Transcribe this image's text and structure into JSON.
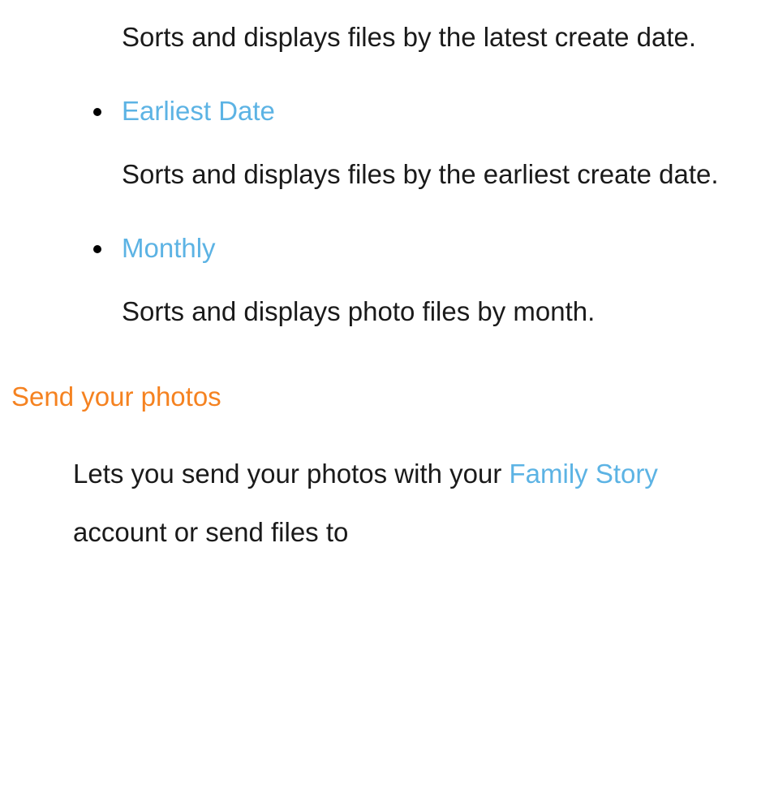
{
  "items": {
    "latestDate": {
      "desc": "Sorts and displays files by the latest create date."
    },
    "earliestDate": {
      "title": "Earliest Date",
      "desc": "Sorts and displays files by the earliest create date."
    },
    "monthly": {
      "title": "Monthly",
      "desc": "Sorts and displays photo files by month."
    }
  },
  "section": {
    "heading": "Send your photos",
    "body_part1": "Lets you send your photos with your ",
    "body_link": "Family Story",
    "body_part2": " account or send files to"
  }
}
